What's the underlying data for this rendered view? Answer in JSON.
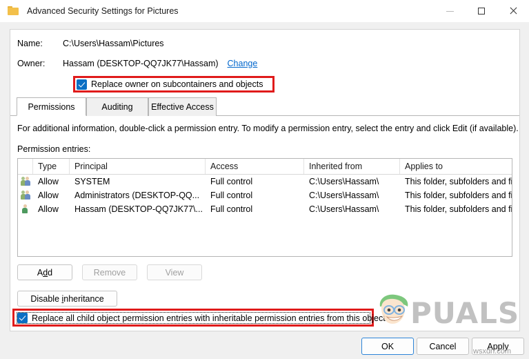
{
  "window": {
    "title": "Advanced Security Settings for Pictures",
    "icon": "folder-icon",
    "controls": {
      "minimize": "minimize-icon",
      "maximize": "maximize-icon",
      "close": "close-icon"
    }
  },
  "fields": {
    "name_label": "Name:",
    "name_value": "C:\\Users\\Hassam\\Pictures",
    "owner_label": "Owner:",
    "owner_value": "Hassam (DESKTOP-QQ7JK77\\Hassam)",
    "owner_change_link": "Change"
  },
  "replace_owner": {
    "label": "Replace owner on subcontainers and objects",
    "checked": true,
    "highlighted": true,
    "highlight_color": "#e01b1b"
  },
  "tabs": [
    {
      "label": "Permissions",
      "active": true
    },
    {
      "label": "Auditing",
      "active": false
    },
    {
      "label": "Effective Access",
      "active": false
    }
  ],
  "info_text": "For additional information, double-click a permission entry. To modify a permission entry, select the entry and click Edit (if available).",
  "entries_label": "Permission entries:",
  "permission_table": {
    "columns": [
      "Type",
      "Principal",
      "Access",
      "Inherited from",
      "Applies to"
    ],
    "rows": [
      {
        "icon": "group-icon",
        "type": "Allow",
        "principal": "SYSTEM",
        "access": "Full control",
        "inherited_from": "C:\\Users\\Hassam\\",
        "applies_to": "This folder, subfolders and files"
      },
      {
        "icon": "group-icon",
        "type": "Allow",
        "principal": "Administrators (DESKTOP-QQ...",
        "access": "Full control",
        "inherited_from": "C:\\Users\\Hassam\\",
        "applies_to": "This folder, subfolders and files"
      },
      {
        "icon": "user-icon",
        "type": "Allow",
        "principal": "Hassam (DESKTOP-QQ7JK77\\...",
        "access": "Full control",
        "inherited_from": "C:\\Users\\Hassam\\",
        "applies_to": "This folder, subfolders and files"
      }
    ]
  },
  "list_buttons": {
    "add": "Add",
    "add_accel": "d",
    "remove": "Remove",
    "remove_enabled": false,
    "view": "View",
    "view_enabled": false
  },
  "inheritance_button": {
    "label": "Disable inheritance",
    "accel": "i"
  },
  "replace_child": {
    "label": "Replace all child object permission entries with inheritable permission entries from this object",
    "checked": true,
    "highlighted": true,
    "focused": true,
    "highlight_color": "#e01b1b"
  },
  "action_buttons": {
    "ok": "OK",
    "cancel": "Cancel",
    "apply": "Apply",
    "default_focus": "OK",
    "focus_color": "#2c84d8"
  },
  "watermarks": {
    "brand": "PUALS",
    "site": "wsxdn.com"
  }
}
